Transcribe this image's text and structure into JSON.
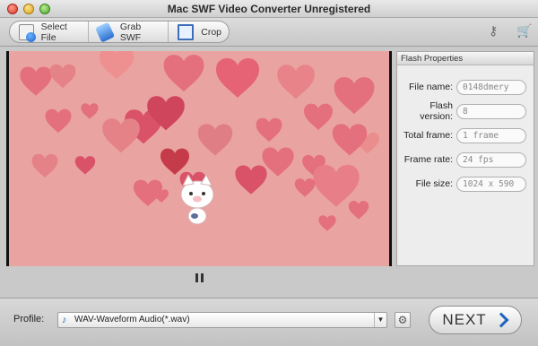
{
  "window": {
    "title": "Mac SWF Video Converter Unregistered"
  },
  "toolbar": {
    "buttons": [
      {
        "label": "Select File",
        "icon": "file-icon"
      },
      {
        "label": "Grab SWF",
        "icon": "grab-icon"
      },
      {
        "label": "Crop",
        "icon": "crop-icon"
      }
    ],
    "right_icons": [
      "key-icon",
      "cart-icon"
    ]
  },
  "player": {
    "state_icon": "pause-icon"
  },
  "flash_properties": {
    "title": "Flash Properties",
    "rows": [
      {
        "label": "File name:",
        "value": "0148dmery"
      },
      {
        "label": "Flash version:",
        "value": "8"
      },
      {
        "label": "Total frame:",
        "value": "1 frame"
      },
      {
        "label": "Frame rate:",
        "value": "24 fps"
      },
      {
        "label": "File size:",
        "value": "1024 x 590"
      }
    ]
  },
  "bottom": {
    "profile_label": "Profile:",
    "profile_value": "WAV-Waveform Audio(*.wav)",
    "next_label": "NEXT"
  },
  "colors": {
    "video_bg": "#e9a3a1",
    "heart": "#e0586c",
    "accent": "#1e63c2"
  }
}
